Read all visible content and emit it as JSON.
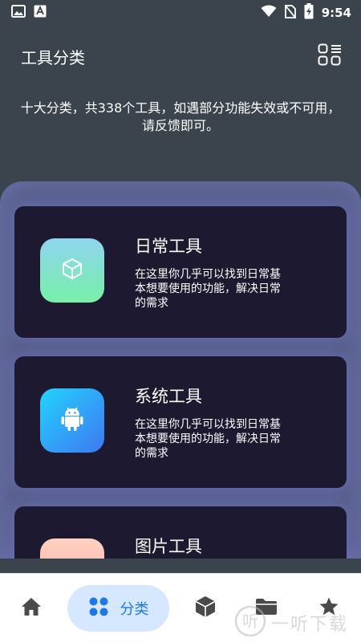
{
  "status_bar": {
    "time": "9:54",
    "icons": [
      "image-icon",
      "font-app-icon",
      "wifi-icon",
      "no-sim-icon",
      "battery-charging-icon"
    ]
  },
  "header": {
    "title": "工具分类",
    "action_icon": "grid-list-icon"
  },
  "intro": {
    "text": "十大分类，共338个工具，如遇部分功能失效或不可用，请反馈即可。"
  },
  "categories": [
    {
      "title": "日常工具",
      "description": "在这里你几乎可以找到日常基本想要使用的功能，解决日常的需求",
      "icon": "cube-outline-icon",
      "gradient": [
        "#8fd4f0",
        "#78f0a8"
      ]
    },
    {
      "title": "系统工具",
      "description": "在这里你几乎可以找到日常基本想要使用的功能，解决日常的需求",
      "icon": "android-icon",
      "gradient": [
        "#22d3ff",
        "#3f78f0"
      ]
    },
    {
      "title": "图片工具",
      "icon": "image-icon",
      "gradient": [
        "#ffd0c0",
        "#ffb0a8"
      ]
    }
  ],
  "bottom_nav": {
    "items": [
      {
        "icon": "home-icon"
      },
      {
        "icon": "category-dots-icon",
        "label": "分类",
        "active": true
      },
      {
        "icon": "cube-icon"
      },
      {
        "icon": "folder-icon"
      },
      {
        "icon": "star-icon"
      }
    ]
  },
  "watermark": {
    "text": "一听下载",
    "logo_glyph": "听"
  },
  "colors": {
    "background": "#3b444d",
    "sheet": "#59608a",
    "card": "#1c1930",
    "nav_active_bg": "#d5e8ff",
    "nav_active_fg": "#1e78e8",
    "nav_inactive": "#4a4a4a"
  }
}
